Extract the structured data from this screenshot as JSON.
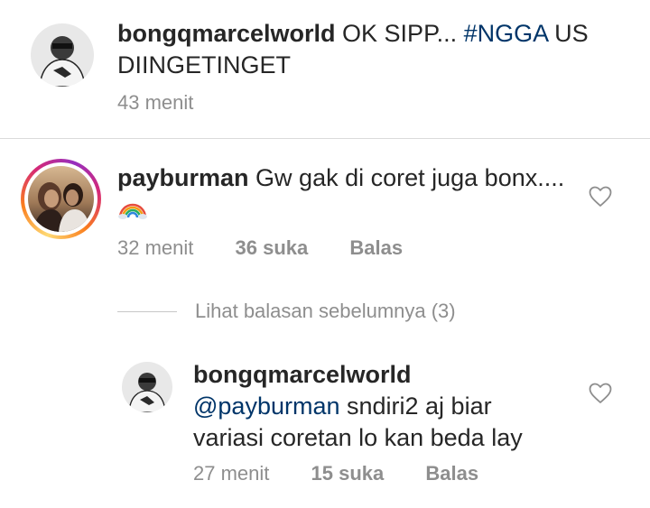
{
  "caption": {
    "username": "bongqmarcelworld",
    "text_prefix": " OK SIPP... ",
    "hashtag": "#NGGA",
    "text_suffix": " US DIINGETINGET",
    "time": "43 menit"
  },
  "comment": {
    "username": "payburman",
    "text": " Gw gak di coret juga bonx....",
    "emoji": "rainbow-emoji",
    "time": "32 menit",
    "likes": "36 suka",
    "reply_label": "Balas"
  },
  "view_previous_replies": "Lihat balasan sebelumnya (3)",
  "reply": {
    "username": "bongqmarcelworld",
    "mention": "@payburman",
    "text": " sndiri2 aj biar variasi coretan lo kan beda lay",
    "time": "27 menit",
    "likes": "15 suka",
    "reply_label": "Balas"
  },
  "icons": {
    "like": "heart-outline-icon"
  },
  "colors": {
    "link": "#003569",
    "meta": "#8e8e8e",
    "text": "#262626",
    "divider": "#dbdbdb"
  }
}
